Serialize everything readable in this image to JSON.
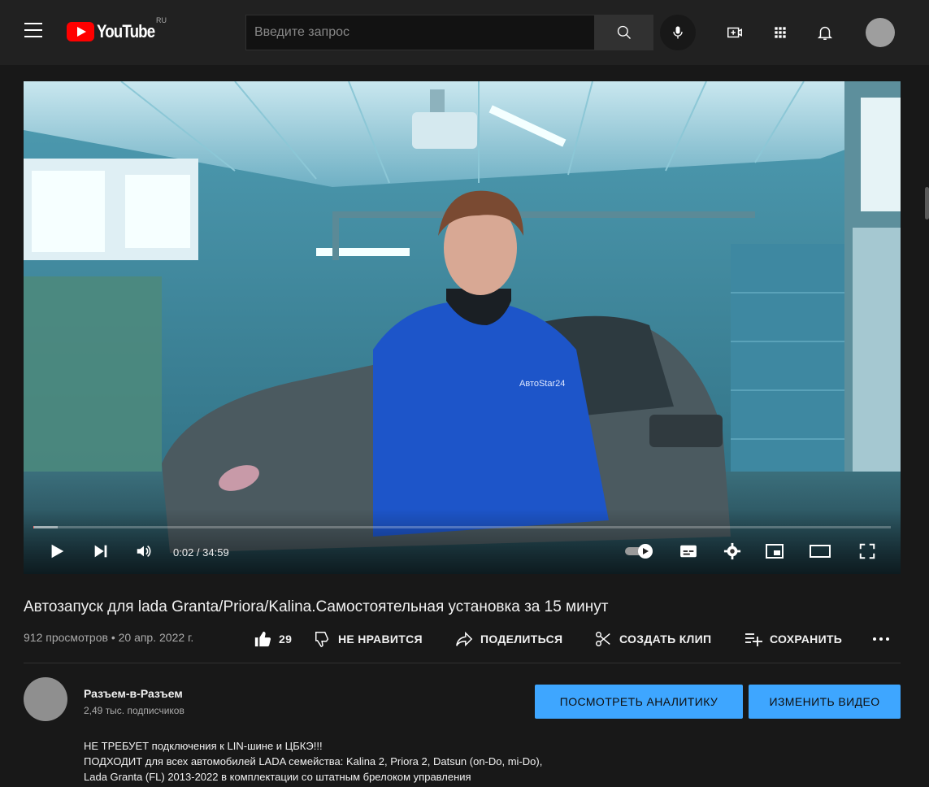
{
  "header": {
    "logo_text": "YouTube",
    "region": "RU",
    "search_placeholder": "Введите запрос"
  },
  "player": {
    "time_display": "0:02 / 34:59",
    "progress_fraction": 0.001,
    "buffer_fraction": 0.028
  },
  "video": {
    "title": "Автозапуск для lada Granta/Priora/Kalina.Самостоятельная установка за 15 минут",
    "views_date": "912 просмотров • 20 апр. 2022 г.",
    "like_count": "29",
    "dislike_label": "НЕ НРАВИТСЯ",
    "share_label": "ПОДЕЛИТЬСЯ",
    "clip_label": "СОЗДАТЬ КЛИП",
    "save_label": "СОХРАНИТЬ"
  },
  "channel": {
    "name": "Разъем-в-Разъем",
    "subscribers": "2,49 тыс. подписчиков",
    "analytics_button": "ПОСМОТРЕТЬ АНАЛИТИКУ",
    "edit_button": "ИЗМЕНИТЬ ВИДЕО"
  },
  "description": {
    "lines": [
      "НЕ ТРЕБУЕТ подключения к LIN-шине и ЦБКЭ!!!",
      "ПОДХОДИТ для всех автомобилей LADA семейства: Kalina 2, Priora 2, Datsun (on-Do, mi-Do),",
      "Lada Granta (FL) 2013-2022 в комплектации со штатным брелоком управления"
    ]
  },
  "colors": {
    "brand_red": "#ff0000",
    "accent_blue": "#3ea6ff",
    "background": "#181818"
  }
}
